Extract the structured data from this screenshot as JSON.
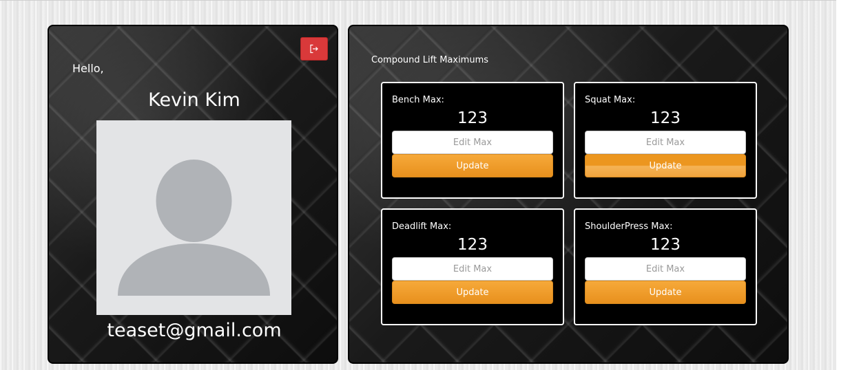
{
  "profile": {
    "greeting": "Hello,",
    "name": "Kevin Kim",
    "email": "teaset@gmail.com"
  },
  "lifts": {
    "section_title": "Compound Lift Maximums",
    "edit_placeholder": "Edit Max",
    "update_label": "Update",
    "items": [
      {
        "label": "Bench Max:",
        "value": "123"
      },
      {
        "label": "Squat Max:",
        "value": "123"
      },
      {
        "label": "Deadlift Max:",
        "value": "123"
      },
      {
        "label": "ShoulderPress Max:",
        "value": "123"
      }
    ]
  },
  "icons": {
    "logout": "sign-out-icon",
    "avatar": "default-user-avatar"
  },
  "colors": {
    "logout_button": "#d9393a",
    "update_button": "#f0a030",
    "avatar_background": "#e3e4e6",
    "avatar_silhouette": "#b0b3b7"
  }
}
